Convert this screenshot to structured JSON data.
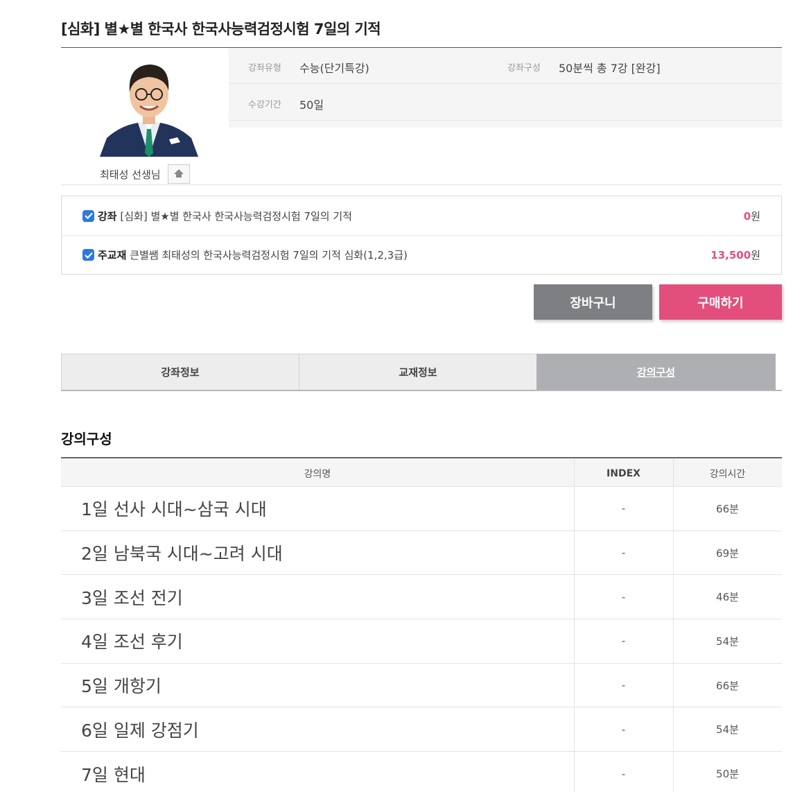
{
  "page": {
    "title": "[심화] 별★별 한국사 한국사능력검정시험 7일의 기적"
  },
  "teacher": {
    "name": "최태성 선생님",
    "home_icon": "home-icon"
  },
  "info": {
    "type_label": "강좌유형",
    "type_value": "수능(단기특강)",
    "compose_label": "강좌구성",
    "compose_value": "50분씩 총 7강 [완강]",
    "period_label": "수강기간",
    "period_value": "50일"
  },
  "items": [
    {
      "tag": "강좌",
      "name": "[심화] 별★별 한국사 한국사능력검정시험 7일의 기적",
      "price": "0",
      "unit": "원",
      "checked": true
    },
    {
      "tag": "주교재",
      "name": "큰별쌤 최태성의 한국사능력검정시험 7일의 기적 심화(1,2,3급)",
      "price": "13,500",
      "unit": "원",
      "checked": true
    }
  ],
  "buttons": {
    "cart": "장바구니",
    "buy": "구매하기"
  },
  "tabs": [
    "강좌정보",
    "교재정보",
    "강의구성"
  ],
  "section": {
    "title": "강의구성"
  },
  "table": {
    "headers": [
      "강의명",
      "INDEX",
      "강의시간"
    ],
    "rows": [
      {
        "name": "1일 선사 시대~삼국 시대",
        "index": "-",
        "time": "66분"
      },
      {
        "name": "2일 남북국 시대~고려 시대",
        "index": "-",
        "time": "69분"
      },
      {
        "name": "3일 조선 전기",
        "index": "-",
        "time": "46분"
      },
      {
        "name": "4일 조선 후기",
        "index": "-",
        "time": "54분"
      },
      {
        "name": "5일 개항기",
        "index": "-",
        "time": "66분"
      },
      {
        "name": "6일 일제 강점기",
        "index": "-",
        "time": "54분"
      },
      {
        "name": "7일 현대",
        "index": "-",
        "time": "50분"
      }
    ]
  },
  "colors": {
    "accent_pink": "#e34f7c",
    "cart_gray": "#7e7f83",
    "checkbox_blue": "#2d78e0"
  }
}
